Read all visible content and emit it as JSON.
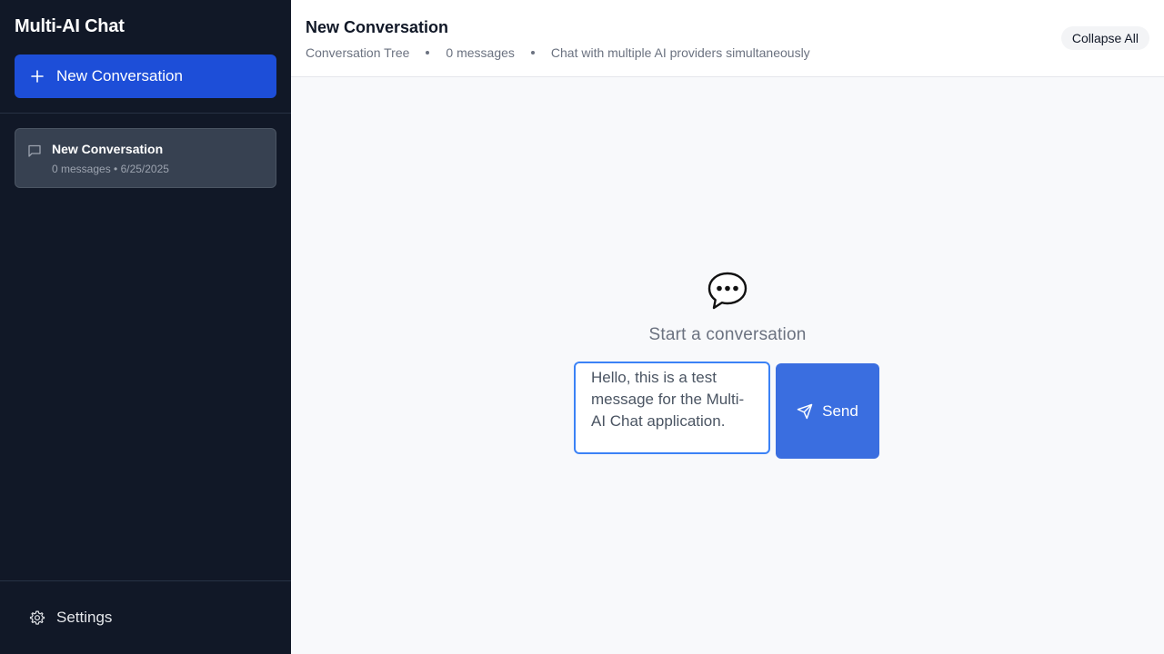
{
  "sidebar": {
    "app_title": "Multi-AI Chat",
    "new_conversation_label": "New Conversation",
    "conversations": [
      {
        "title": "New Conversation",
        "meta": "0 messages • 6/25/2025"
      }
    ],
    "settings_label": "Settings"
  },
  "header": {
    "title": "New Conversation",
    "view_label": "Conversation Tree",
    "message_count": "0 messages",
    "description": "Chat with multiple AI providers simultaneously",
    "collapse_label": "Collapse All"
  },
  "main": {
    "empty_state_label": "Start a conversation",
    "input_value": "Hello, this is a test message for the Multi-AI Chat application.",
    "send_label": "Send"
  },
  "icons": {
    "new_conversation": "plus-icon",
    "conversation": "chat-bubble-icon",
    "settings": "gear-icon",
    "empty_state": "speech-balloon-icon",
    "send": "send-icon"
  },
  "colors": {
    "sidebar_bg": "#111827",
    "primary": "#1d4ed8",
    "send_button": "#3a6ee0",
    "input_border": "#3b82f6",
    "main_bg": "#f8f9fb"
  }
}
